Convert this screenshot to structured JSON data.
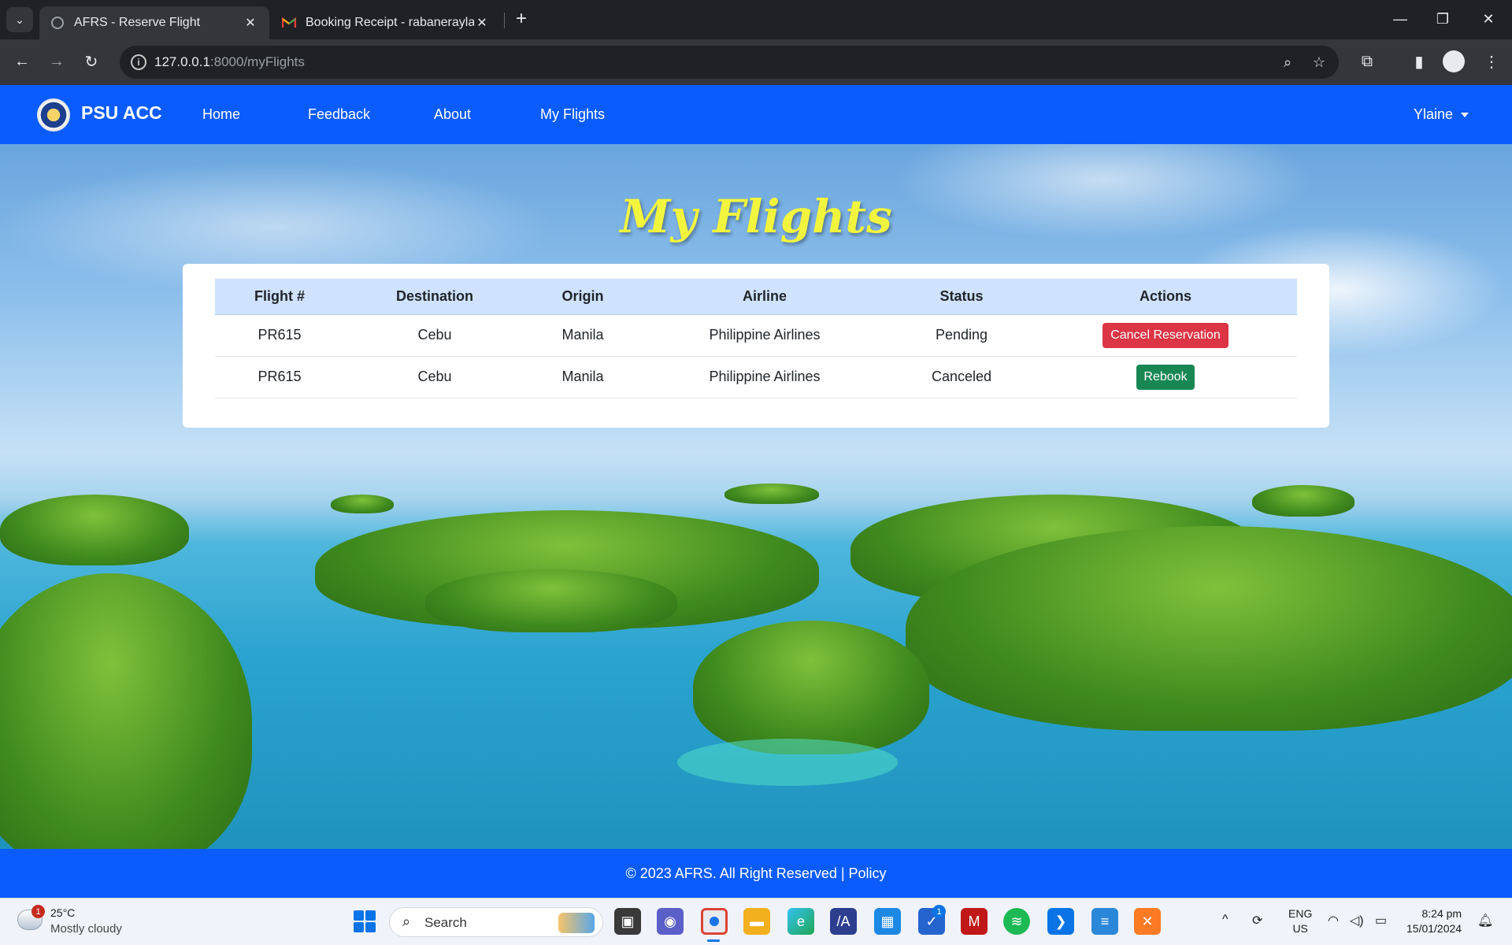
{
  "browser": {
    "tabs": [
      {
        "title": "AFRS - Reserve Flight",
        "active": true
      },
      {
        "title": "Booking Receipt - rabaneraylaine",
        "active": false
      }
    ],
    "url": {
      "host": "127.0.0.1",
      "rest": ":8000/myFlights"
    }
  },
  "navbar": {
    "brand": "PSU ACC",
    "links": [
      "Home",
      "Feedback",
      "About",
      "My Flights"
    ],
    "user": "Ylaine"
  },
  "page": {
    "title": "My Flights",
    "table": {
      "headers": [
        "Flight #",
        "Destination",
        "Origin",
        "Airline",
        "Status",
        "Actions"
      ],
      "rows": [
        {
          "flight": "PR615",
          "destination": "Cebu",
          "origin": "Manila",
          "airline": "Philippine Airlines",
          "status": "Pending",
          "action": "Cancel Reservation"
        },
        {
          "flight": "PR615",
          "destination": "Cebu",
          "origin": "Manila",
          "airline": "Philippine Airlines",
          "status": "Canceled",
          "action": "Rebook"
        }
      ]
    },
    "footer": "© 2023 AFRS. All Right Reserved | Policy"
  },
  "taskbar": {
    "weather": {
      "badge": "1",
      "temp": "25°C",
      "desc": "Mostly cloudy"
    },
    "search": "Search",
    "todo_badge": "1",
    "lang": {
      "line1": "ENG",
      "line2": "US"
    },
    "clock": {
      "time": "8:24 pm",
      "date": "15/01/2024"
    }
  },
  "colors": {
    "navbar": "#0a5cff",
    "title": "#f2f53d",
    "table_header": "#cfe2ff",
    "danger": "#dc3545",
    "success": "#198754"
  }
}
